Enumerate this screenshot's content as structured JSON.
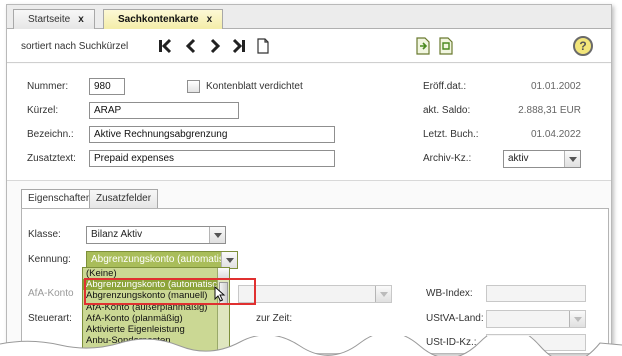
{
  "tabs": [
    {
      "label": "Startseite",
      "close": "x"
    },
    {
      "label": "Sachkontenkarte",
      "close": "x"
    }
  ],
  "toolbar": {
    "sort_label": "sortiert nach Suchkürzel",
    "nav_icons": [
      "first-record-icon",
      "previous-record-icon",
      "next-record-icon",
      "last-record-icon",
      "new-document-icon"
    ],
    "help_label": "?"
  },
  "header": {
    "nummer_label": "Nummer:",
    "nummer_value": "980",
    "kontenblatt_label": "Kontenblatt verdichtet",
    "kuerzel_label": "Kürzel:",
    "kuerzel_value": "ARAP",
    "bezeichn_label": "Bezeichn.:",
    "bezeichn_value": "Aktive Rechnungsabgrenzung",
    "zusatztext_label": "Zusatztext:",
    "zusatztext_value": "Prepaid expenses",
    "eroeff_label": "Eröff.dat.:",
    "eroeff_value": "01.01.2002",
    "saldo_label": "akt. Saldo:",
    "saldo_value": "2.888,31 EUR",
    "letzt_label": "Letzt. Buch.:",
    "letzt_value": "01.04.2022",
    "archiv_label": "Archiv-Kz.:",
    "archiv_value": "aktiv"
  },
  "subtabs": [
    "Eigenschaften",
    "Zusatzfelder"
  ],
  "props": {
    "klasse_label": "Klasse:",
    "klasse_value": "Bilanz Aktiv",
    "kennung_label": "Kennung:",
    "kennung_value": "Abgrenzungskonto (automatisch",
    "afa_label": "AfA-Konto",
    "steuerart_label": "Steuerart:",
    "zurzeit_label": "zur Zeit:",
    "wbindex_label": "WB-Index:",
    "ustva_label": "UStVA-Land:",
    "ustid_label": "USt-ID-Kz.:"
  },
  "kennung_options": [
    "(Keine)",
    "Abgrenzungskonto (automatisch",
    "Abgrenzungskonto (manuell)",
    "AfA-Konto (außerplanmäßig)",
    "AfA-Konto (planmäßig)",
    "Aktivierte Eigenleistung",
    "Anbu-Sonderposten"
  ],
  "colors": {
    "accent_green": "#a9bd5a",
    "highlight_green": "#8da43a",
    "highlight_box": "#e03030"
  }
}
